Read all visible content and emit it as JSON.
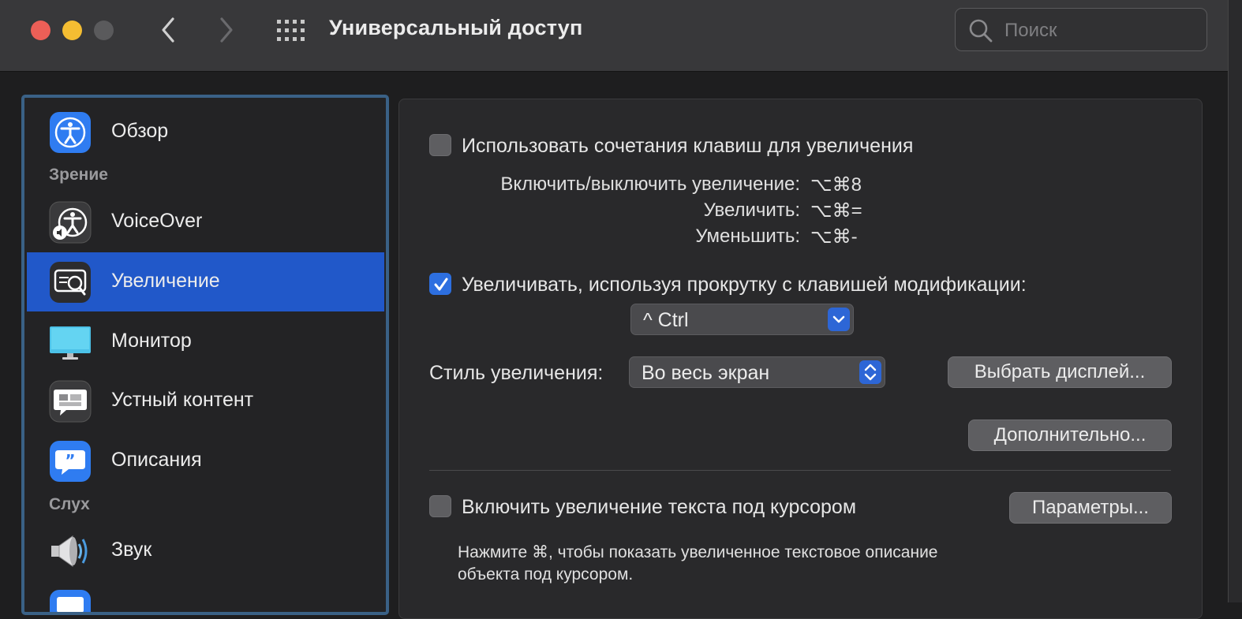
{
  "window": {
    "title": "Универсальный доступ",
    "search_placeholder": "Поиск"
  },
  "sidebar": {
    "items": [
      {
        "label": "Обзор",
        "icon": "accessibility-icon"
      },
      {
        "label": "VoiceOver",
        "icon": "voiceover-icon"
      },
      {
        "label": "Увеличение",
        "icon": "zoom-icon",
        "selected": true
      },
      {
        "label": "Монитор",
        "icon": "display-icon"
      },
      {
        "label": "Устный контент",
        "icon": "spoken-content-icon"
      },
      {
        "label": "Описания",
        "icon": "descriptions-icon"
      },
      {
        "label": "Звук",
        "icon": "speaker-icon"
      }
    ],
    "sections": {
      "vision": "Зрение",
      "hearing": "Слух"
    }
  },
  "zoom": {
    "keyboard_shortcuts": {
      "label": "Использовать сочетания клавиш для увеличения",
      "checked": false,
      "shortcuts": [
        {
          "label": "Включить/выключить увеличение:",
          "keys": "⌥⌘8"
        },
        {
          "label": "Увеличить:",
          "keys": "⌥⌘="
        },
        {
          "label": "Уменьшить:",
          "keys": "⌥⌘-"
        }
      ]
    },
    "scroll_gesture": {
      "label": "Увеличивать, используя прокрутку с клавишей модификации:",
      "checked": true,
      "modifier_value": "^ Ctrl"
    },
    "zoom_style": {
      "label": "Стиль увеличения:",
      "value": "Во весь экран",
      "choose_display_label": "Выбрать дисплей..."
    },
    "advanced_label": "Дополнительно...",
    "hover_text": {
      "label": "Включить увеличение текста под курсором",
      "checked": false,
      "options_label": "Параметры...",
      "hint_line1": "Нажмите ⌘, чтобы показать увеличенное текстовое описание",
      "hint_line2": "объекта под курсором."
    }
  },
  "colors": {
    "accent": "#2158c9",
    "close": "#ec5f57",
    "minimize": "#f4bd32"
  }
}
